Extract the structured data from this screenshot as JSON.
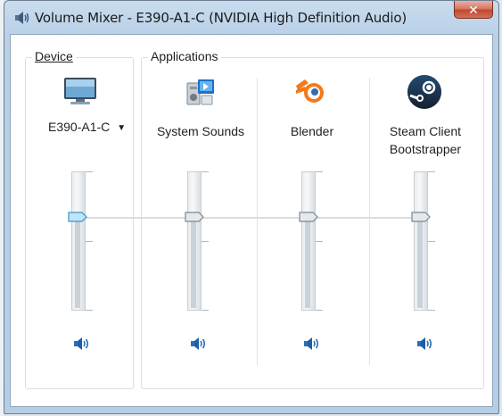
{
  "window": {
    "title": "Volume Mixer - E390-A1-C (NVIDIA High Definition Audio)",
    "close_glyph": "✕"
  },
  "device": {
    "group_label": "Device",
    "icon": "monitor-icon",
    "selected": "E390-A1-C",
    "volume_percent": 50,
    "mute_icon": "speaker-icon"
  },
  "applications": {
    "group_label": "Applications",
    "items": [
      {
        "name": "System Sounds",
        "icon": "system-sounds-icon",
        "volume_percent": 50
      },
      {
        "name": "Blender",
        "icon": "blender-icon",
        "volume_percent": 50
      },
      {
        "name_line1": "Steam Client",
        "name_line2": "Bootstrapper",
        "icon": "steam-icon",
        "volume_percent": 50
      }
    ]
  },
  "colors": {
    "accent": "#4aa3df",
    "blender_orange": "#f37a1b",
    "steam_navy": "#1b2838"
  }
}
